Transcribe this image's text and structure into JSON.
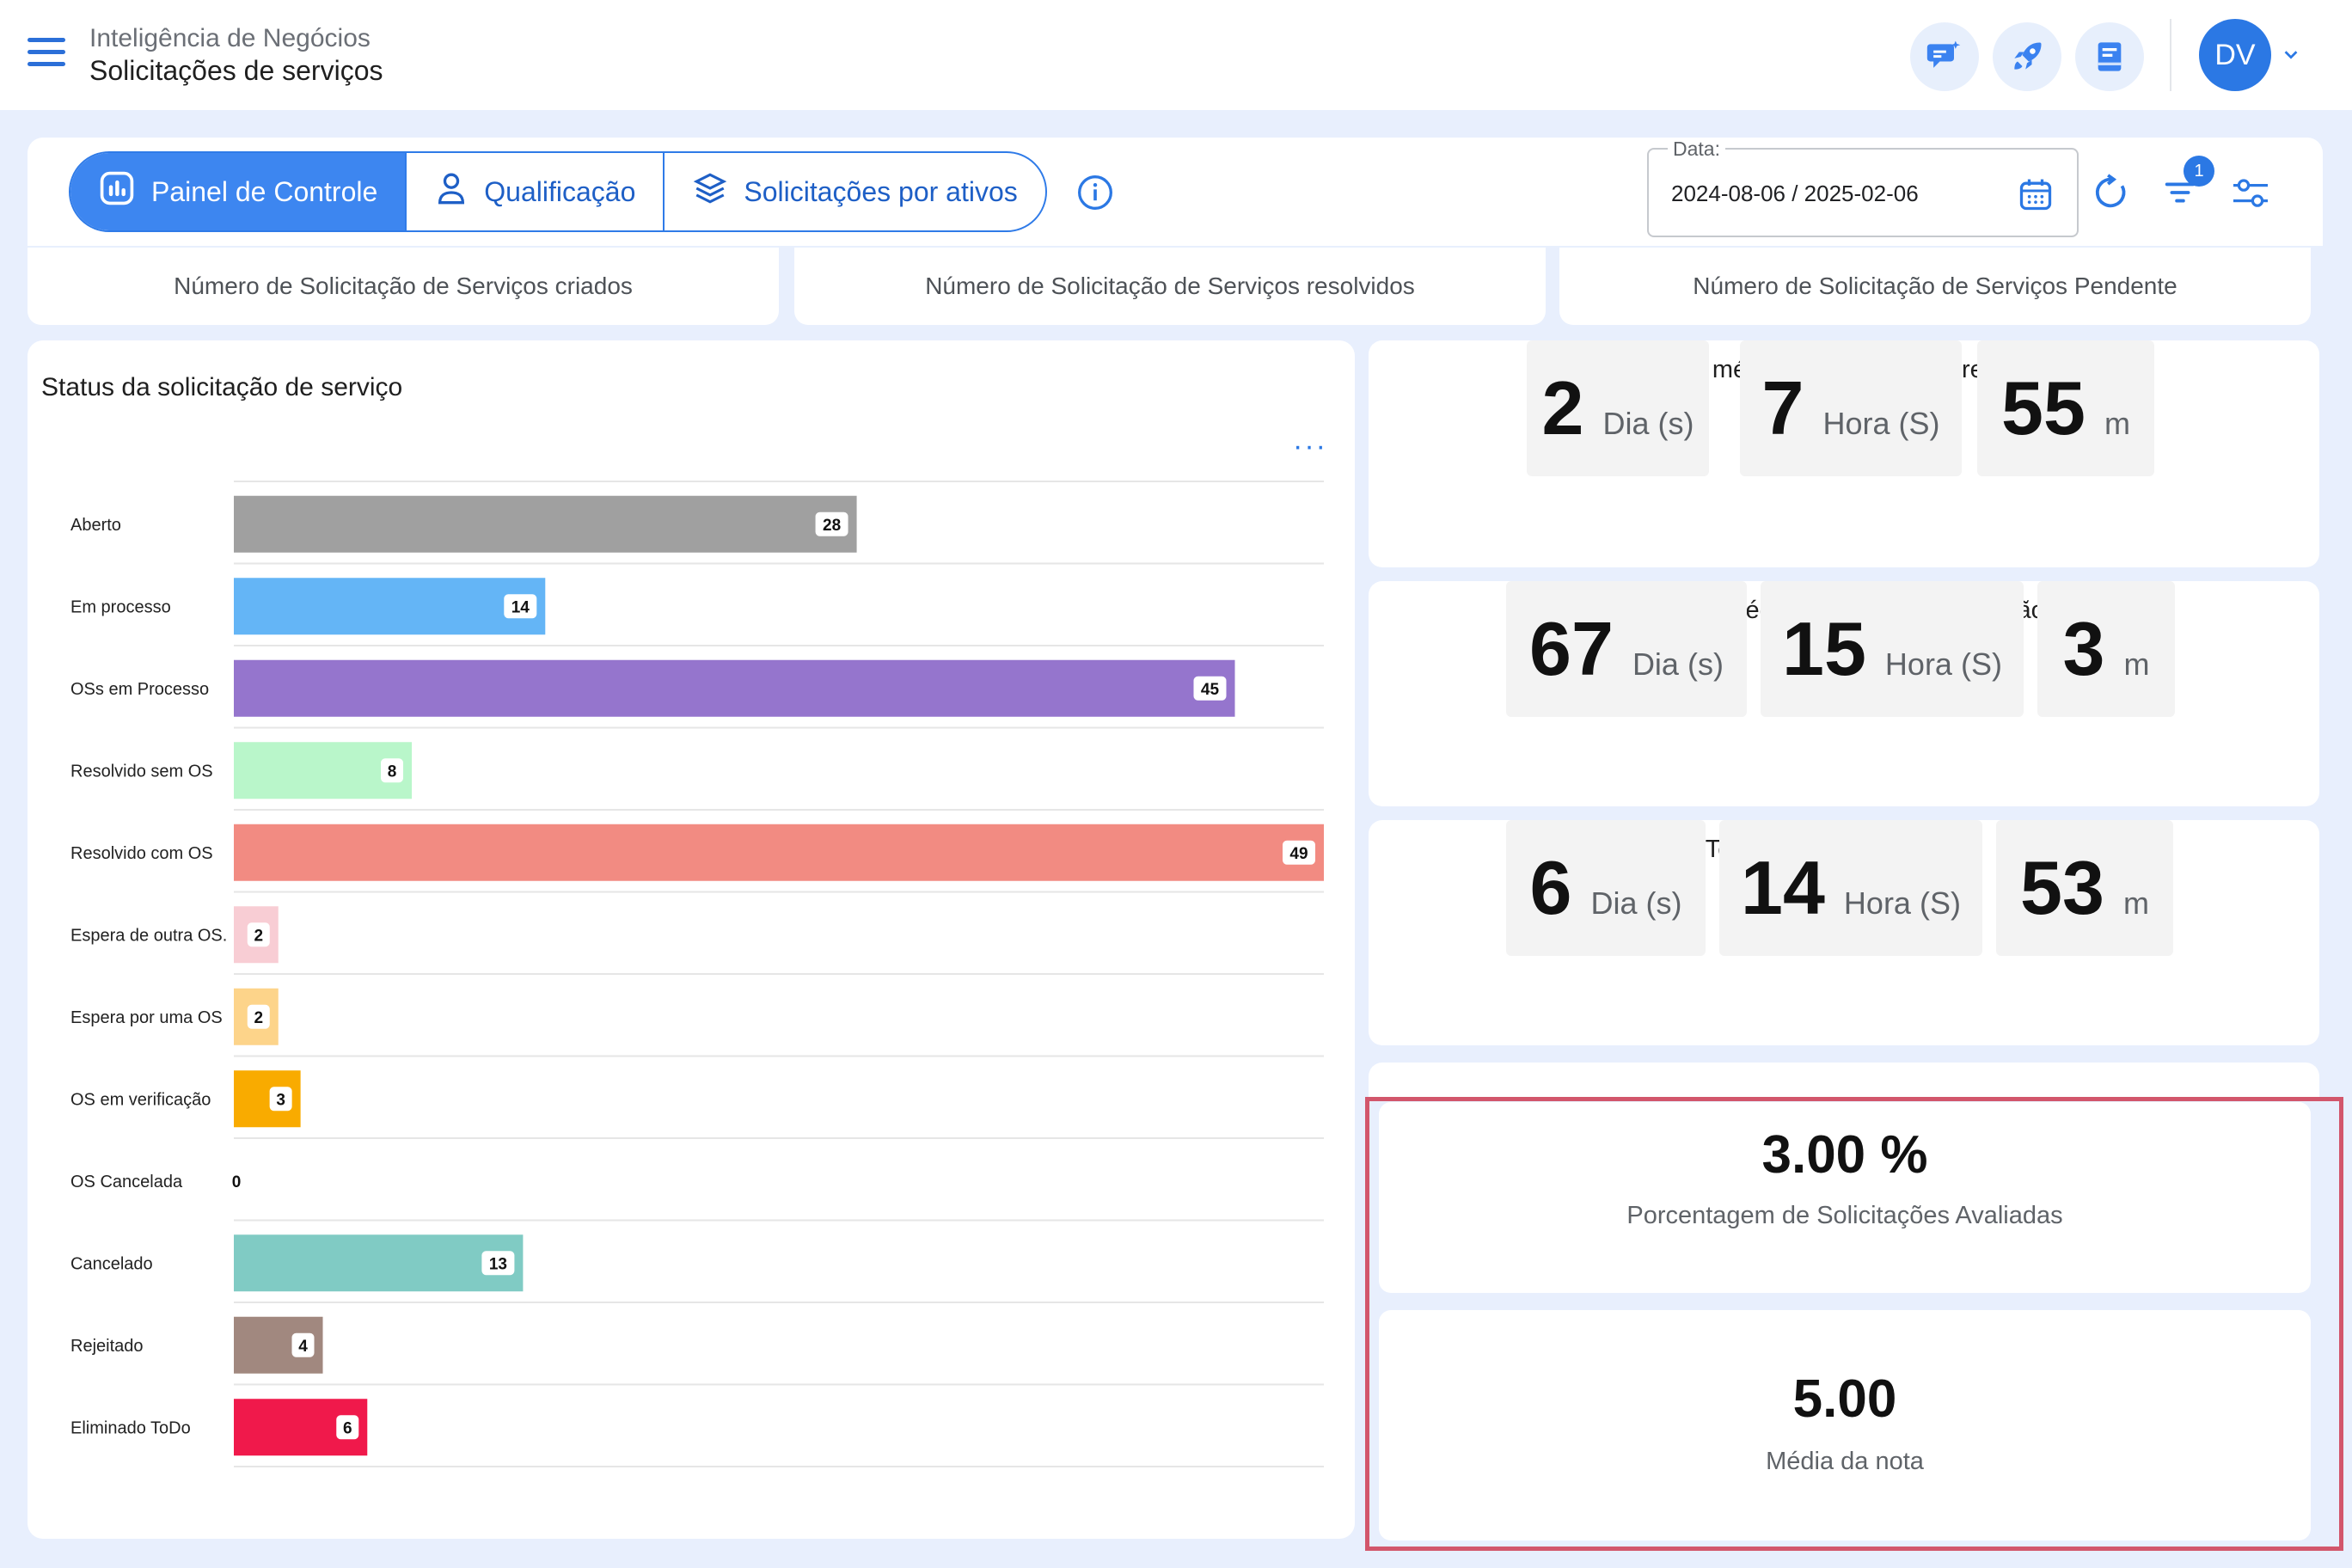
{
  "header": {
    "subtitle": "Inteligência de Negócios",
    "title": "Solicitações de serviços",
    "avatar_initials": "DV",
    "icons": [
      "chat-sparkle-icon",
      "rocket-icon",
      "notebook-icon"
    ]
  },
  "tabs": [
    {
      "label": "Painel de Controle",
      "icon": "dashboard-icon",
      "active": true
    },
    {
      "label": "Qualificação",
      "icon": "person-icon",
      "active": false
    },
    {
      "label": "Solicitações por ativos",
      "icon": "layers-icon",
      "active": false
    }
  ],
  "date_filter": {
    "label": "Data:",
    "value": "2024-08-06 / 2025-02-06"
  },
  "filter_badge": "1",
  "stat_headers": [
    "Número de Solicitação de Serviços criados",
    "Número de Solicitação de Serviços resolvidos",
    "Número de Solicitação de Serviços Pendente"
  ],
  "chart_panel": {
    "title": "Status da solicitação de serviço",
    "more": "···"
  },
  "chart_data": {
    "type": "bar",
    "orientation": "horizontal",
    "categories": [
      "Aberto",
      "Em processo",
      "OSs em Processo",
      "Resolvido sem OS",
      "Resolvido com OS",
      "Espera de outra OS.",
      "Espera por uma OS",
      "OS em verificação",
      "OS Cancelada",
      "Cancelado",
      "Rejeitado",
      "Eliminado ToDo"
    ],
    "values": [
      28,
      14,
      45,
      8,
      49,
      2,
      2,
      3,
      0,
      13,
      4,
      6
    ],
    "colors": [
      "#a0a0a0",
      "#64b5f6",
      "#9575cd",
      "#b9f6ca",
      "#f28b82",
      "#f8cdd4",
      "#fdd48a",
      "#f9ab00",
      "#cccccc",
      "#80cbc4",
      "#a1887f",
      "#f0194b"
    ],
    "xlim": [
      0,
      49
    ],
    "grid": true,
    "title": "Status da solicitação de serviço"
  },
  "time_cards": [
    {
      "title": "Tempo médio para a primeira resposta",
      "days": "2",
      "days_unit": "Dia (s)",
      "hours": "7",
      "hours_unit": "Hora (S)",
      "minutes": "55",
      "minutes_unit": "m"
    },
    {
      "title": "Tempo médio em espera da solução",
      "days": "67",
      "days_unit": "Dia (s)",
      "hours": "15",
      "hours_unit": "Hora (S)",
      "minutes": "3",
      "minutes_unit": "m"
    },
    {
      "title": "Tempo médio da solução",
      "days": "6",
      "days_unit": "Dia (s)",
      "hours": "14",
      "hours_unit": "Hora (S)",
      "minutes": "53",
      "minutes_unit": "m"
    }
  ],
  "metrics": [
    {
      "value": "3.00 %",
      "label": "Porcentagem de Solicitações Avaliadas"
    },
    {
      "value": "5.00",
      "label": "Média da nota"
    }
  ],
  "colors": {
    "accent": "#2b78e4",
    "highlight_border": "#d2566b",
    "page_bg": "#e8effd"
  }
}
